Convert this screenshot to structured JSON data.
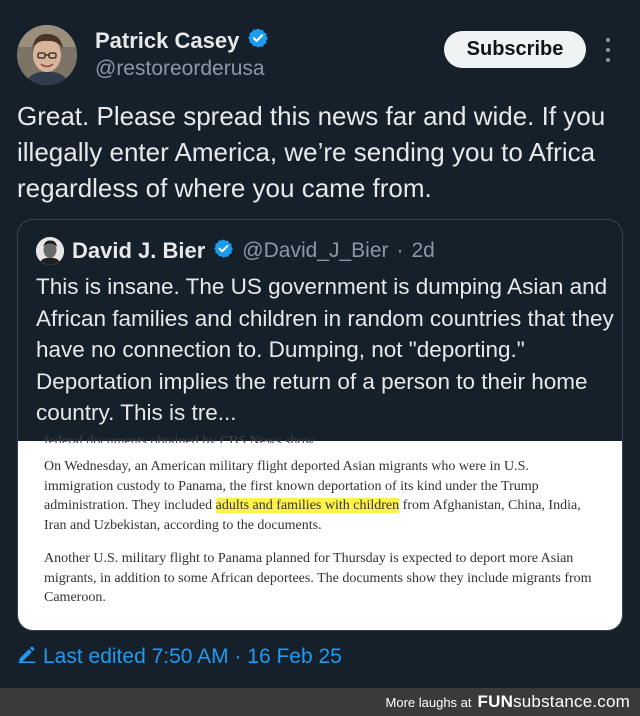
{
  "author": {
    "name": "Patrick Casey",
    "handle": "@restoreorderusa",
    "verified_icon": "verified-badge-icon"
  },
  "actions": {
    "subscribe_label": "Subscribe",
    "more_icon": "more-vertical-icon"
  },
  "tweet_text": "Great. Please spread this news far and wide. If you illegally enter America, we’re sending you to Africa regardless of where you came from.",
  "quoted": {
    "name": "David J. Bier",
    "handle": "@David_J_Bier",
    "separator": "·",
    "time": "2d",
    "text": "This is insane. The US government is dumping Asian and African families and children in random countries that they have no connection to. Dumping, not \"deporting.\" Deportation implies the return of a person to their home country. This is tre...",
    "article": {
      "clipped_line": "federal documents obtained by CBS News show.",
      "p1_before": "On Wednesday, an American military flight deported Asian migrants who were in U.S. immigration custody to Panama, the first known deportation of its kind under the Trump administration. They included ",
      "p1_highlight": "adults and families with children",
      "p1_after": " from Afghanistan, China, India, Iran and Uzbekistan, according to the documents.",
      "p2": "Another U.S. military flight to Panama planned for Thursday is expected to deport more Asian migrants, in addition to some African deportees. The documents show they include migrants from Cameroon."
    }
  },
  "edited": {
    "label": "Last edited 7:50 AM · 16 Feb 25",
    "icon": "edit-pencil-icon"
  },
  "footer": {
    "more_laughs": "More laughs at",
    "logo_fun": "FUN",
    "logo_substance": "substance",
    "logo_com": ".com"
  },
  "colors": {
    "background": "#15202b",
    "accent": "#1d9bf0",
    "secondary_text": "#8b98a5",
    "highlight": "#fff24a"
  }
}
